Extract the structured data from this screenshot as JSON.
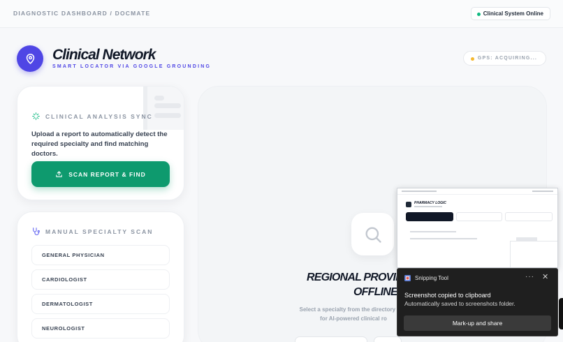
{
  "header": {
    "breadcrumb": "DIAGNOSTIC DASHBOARD / DOCMATE",
    "status": "Clinical System Online"
  },
  "brand": {
    "title": "Clinical Network",
    "subtitle": "SMART LOCATOR VIA GOOGLE GROUNDING",
    "gps": "GPS: ACQUIRING..."
  },
  "analysis": {
    "heading": "CLINICAL ANALYSIS SYNC",
    "description": "Upload a report to automatically detect the required specialty and find matching doctors.",
    "button": "SCAN REPORT & FIND"
  },
  "manual": {
    "heading": "MANUAL SPECIALTY SCAN",
    "items": [
      "GENERAL PHYSICIAN",
      "CARDIOLOGIST",
      "DERMATOLOGIST",
      "NEUROLOGIST"
    ]
  },
  "results": {
    "title_line1": "REGIONAL PROVID",
    "title_line2": "OFFLINE",
    "description_line1": "Select a specialty from the directory or u",
    "description_line2": "for AI-powered clinical ro"
  },
  "preview": {
    "title": "PHARMACY LOGIC"
  },
  "notification": {
    "app": "Snipping Tool",
    "more": "···",
    "close": "✕",
    "title": "Screenshot copied to clipboard",
    "body": "Automatically saved to screenshots folder.",
    "action": "Mark-up and share"
  },
  "colors": {
    "accent": "#4f46e5",
    "primary_button": "#0e9a6e",
    "online": "#10b981",
    "gps_pending": "#f5b82e"
  }
}
